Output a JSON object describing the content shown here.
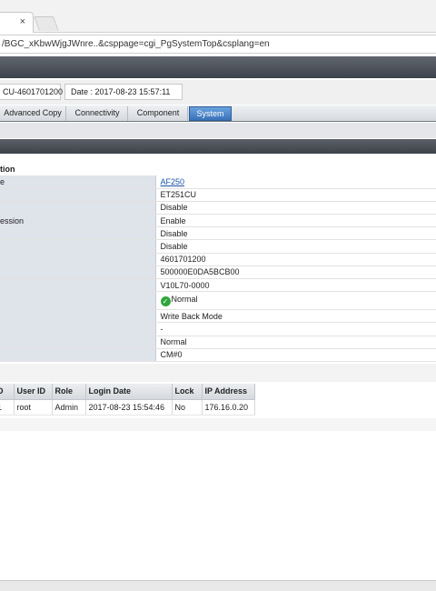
{
  "browser": {
    "tab_close": "×",
    "address": "/BGC_xKbwWjgJWnre..&csppage=cgi_PgSystemTop&csplang=en"
  },
  "infobar": {
    "serial": "CU-4601701200",
    "date": "Date : 2017-08-23 15:57:11"
  },
  "nav": {
    "tabs": [
      {
        "label": "Advanced Copy"
      },
      {
        "label": "Connectivity"
      },
      {
        "label": "Component"
      },
      {
        "label": "System"
      }
    ],
    "selected": "System"
  },
  "system": {
    "section_title": "tion",
    "rows": [
      {
        "label": "e",
        "value": "AF250",
        "link": true
      },
      {
        "label": "",
        "value": "ET251CU"
      },
      {
        "label": "",
        "value": "Disable"
      },
      {
        "label": "ession",
        "value": "Enable"
      },
      {
        "label": "",
        "value": "Disable"
      },
      {
        "label": "",
        "value": "Disable"
      },
      {
        "label": "",
        "value": "4601701200"
      },
      {
        "label": "",
        "value": "500000E0DA5BCB00"
      },
      {
        "label": "",
        "value": "V10L70-0000"
      },
      {
        "label": "",
        "value": "Normal",
        "icon": "check-circle-icon"
      },
      {
        "label": "",
        "value": "Write Back Mode"
      },
      {
        "label": "",
        "value": "-"
      },
      {
        "label": "",
        "value": "Normal"
      },
      {
        "label": "",
        "value": "CM#0"
      }
    ]
  },
  "sessions": {
    "columns": [
      "D",
      "User ID",
      "Role",
      "Login Date",
      "Lock",
      "IP Address"
    ],
    "rows": [
      [
        "1",
        "root",
        "Admin",
        "2017-08-23 15:54:46",
        "No",
        "176.16.0.20"
      ]
    ]
  },
  "colors": {
    "header_dark": "#3e434b",
    "selected_tab": "#3a72b9",
    "label_bg": "#dfe3ea",
    "status_ok": "#2fa53c",
    "link": "#1a55a8"
  }
}
